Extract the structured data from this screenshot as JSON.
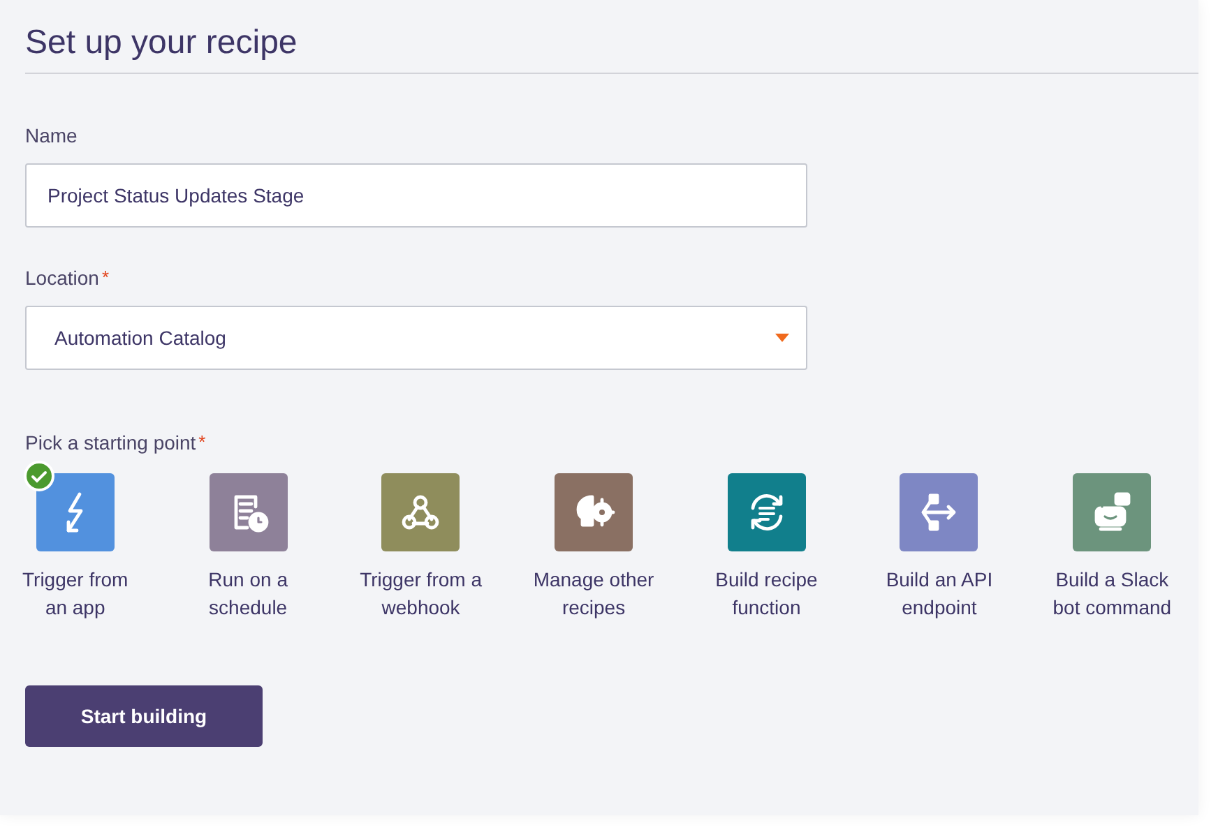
{
  "title": "Set up your recipe",
  "name_field": {
    "label": "Name",
    "value": "Project Status Updates Stage"
  },
  "location_field": {
    "label": "Location",
    "required_mark": "*",
    "value": "Automation Catalog"
  },
  "starting_point": {
    "label": "Pick a starting point",
    "required_mark": "*",
    "options": [
      {
        "kind": "bolt",
        "label": "Trigger from an app",
        "color": "#5291de",
        "selected": true
      },
      {
        "kind": "schedule",
        "label": "Run on a schedule",
        "color": "#8e8199",
        "selected": false
      },
      {
        "kind": "webhook",
        "label": "Trigger from a webhook",
        "color": "#8f8d5c",
        "selected": false
      },
      {
        "kind": "brain",
        "label": "Manage other recipes",
        "color": "#8a7063",
        "selected": false
      },
      {
        "kind": "function",
        "label": "Build recipe function",
        "color": "#117f8c",
        "selected": false
      },
      {
        "kind": "api",
        "label": "Build an API endpoint",
        "color": "#7e87c4",
        "selected": false
      },
      {
        "kind": "bot",
        "label": "Build a Slack bot command",
        "color": "#6c947d",
        "selected": false
      }
    ]
  },
  "start_button": "Start building"
}
